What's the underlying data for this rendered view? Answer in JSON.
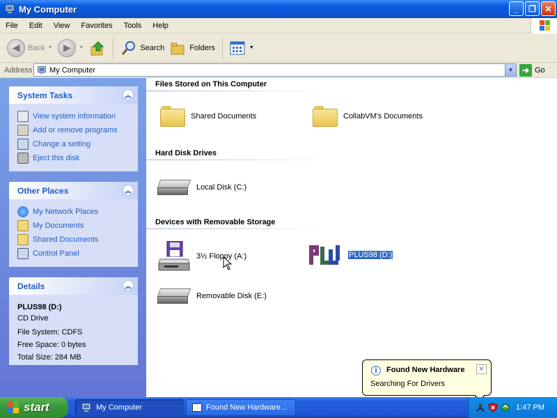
{
  "window": {
    "title": "My Computer"
  },
  "menu": [
    "File",
    "Edit",
    "View",
    "Favorites",
    "Tools",
    "Help"
  ],
  "toolbar": {
    "back": "Back",
    "search": "Search",
    "folders": "Folders"
  },
  "address": {
    "label": "Address",
    "value": "My Computer",
    "go": "Go"
  },
  "system_tasks": {
    "title": "System Tasks",
    "items": [
      "View system information",
      "Add or remove programs",
      "Change a setting",
      "Eject this disk"
    ]
  },
  "other_places": {
    "title": "Other Places",
    "items": [
      "My Network Places",
      "My Documents",
      "Shared Documents",
      "Control Panel"
    ]
  },
  "details": {
    "title": "Details",
    "name": "PLUS98 (D:)",
    "type": "CD Drive",
    "file_system": "File System: CDFS",
    "free_space": "Free Space: 0 bytes",
    "total_size": "Total Size: 284 MB"
  },
  "groups": {
    "files": {
      "header": "Files Stored on This Computer",
      "items": [
        "Shared Documents",
        "CollabVM's Documents"
      ]
    },
    "hdd": {
      "header": "Hard Disk Drives",
      "items": [
        "Local Disk (C:)"
      ]
    },
    "removable": {
      "header": "Devices with Removable Storage",
      "items": [
        "3½ Floppy (A:)",
        "PLUS98 (D:)",
        "Removable Disk (E:)"
      ]
    }
  },
  "balloon": {
    "title": "Found New Hardware",
    "text": "Searching For Drivers"
  },
  "taskbar": {
    "start": "start",
    "tasks": [
      "My Computer",
      "Found New Hardware..."
    ],
    "clock": "1:47 PM"
  },
  "icons": {
    "title": "computer-icon",
    "folder": "folder-icon",
    "hdd": "hard-disk-icon",
    "floppy": "floppy-drive-icon",
    "cd": "plus98-cd-icon"
  },
  "colors": {
    "title_bar": "#0b5ee3",
    "task_pane": "#6f8fe0",
    "link": "#215dc6",
    "selection": "#316ac5",
    "balloon": "#ffffe1",
    "start_button": "#3c9a3a"
  }
}
